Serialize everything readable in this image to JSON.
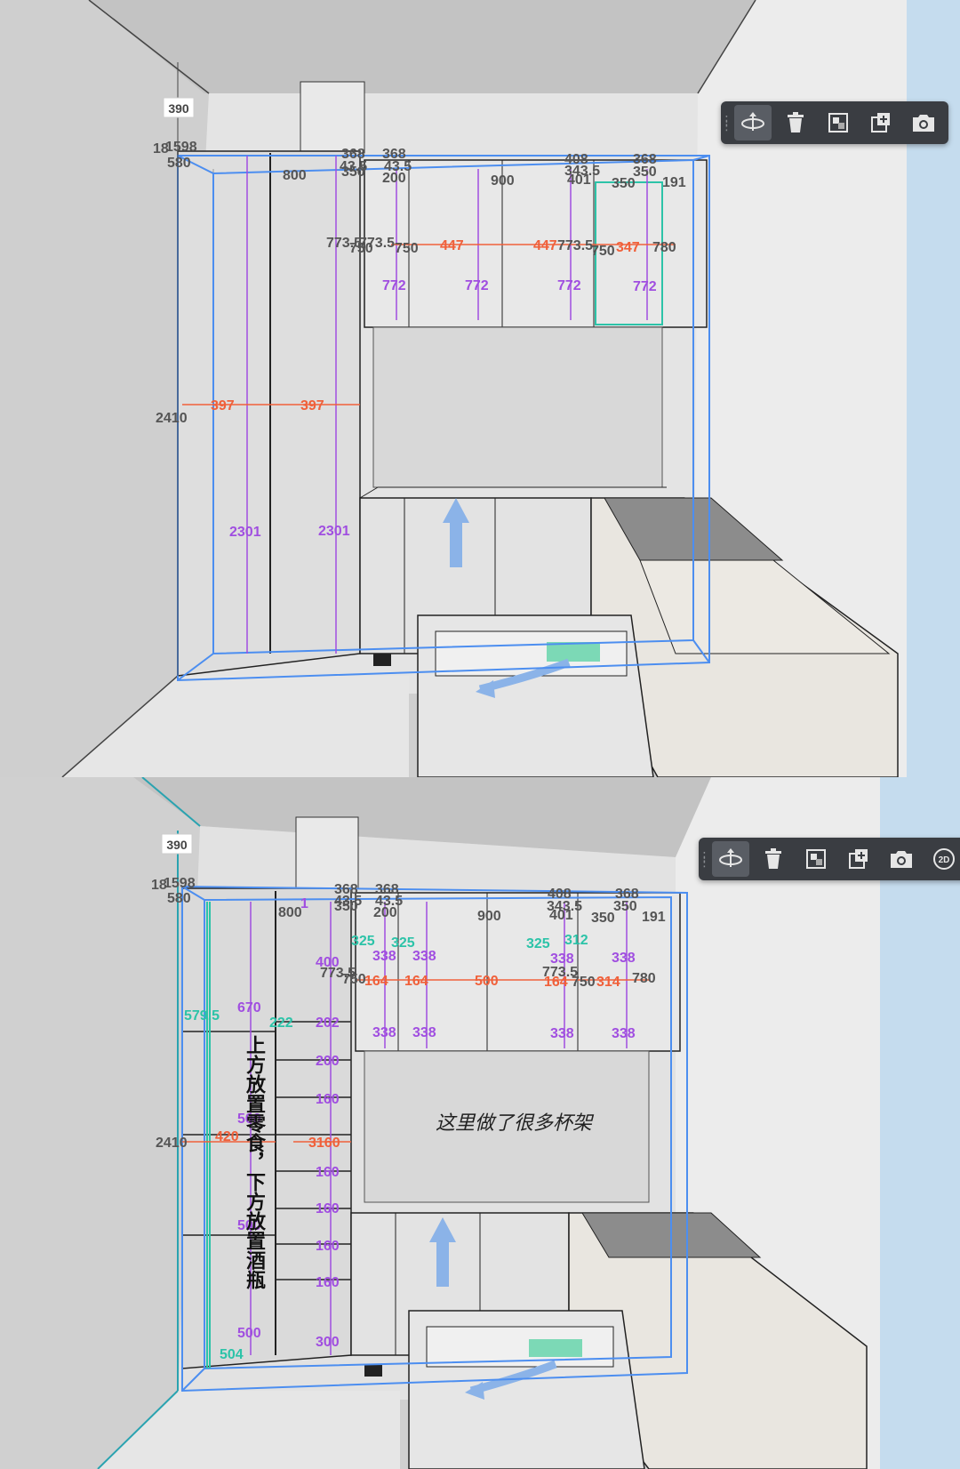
{
  "toolbar": {
    "tools": [
      {
        "name": "rotate",
        "icon": "rotate-3d-icon",
        "active": true
      },
      {
        "name": "delete",
        "icon": "trash-icon"
      },
      {
        "name": "replace",
        "icon": "replace-material-icon"
      },
      {
        "name": "add",
        "icon": "add-copy-icon"
      },
      {
        "name": "camera",
        "icon": "camera-view-icon"
      },
      {
        "name": "2d-view",
        "icon": "view-2d-icon",
        "label": "2D"
      }
    ]
  },
  "colors": {
    "selection": "#4c8ef0",
    "dimension_orange": "#f0603a",
    "dimension_purple": "#a04ee0",
    "dimension_teal": "#2cc3a8",
    "dimension_gray": "#555555",
    "toolbar_bg": "#3a3d42",
    "arrow": "#8bb3e8"
  },
  "top_view": {
    "labels": {
      "l390": "390",
      "l1598": "1598",
      "l18": "18",
      "l580": "580",
      "l800": "800",
      "l368a": "368",
      "l368b": "368",
      "l43_5a": "43.5",
      "l43_5b": "43.5",
      "l350": "350",
      "l200": "200",
      "l900": "900",
      "l408": "408",
      "l343_5": "343.5",
      "l401": "401",
      "l350b": "350",
      "l368c": "368",
      "l350c": "350",
      "l191": "191",
      "l773_5a": "773.5",
      "l773_5b": "773.5",
      "l750a": "750",
      "l750b": "750",
      "l447a": "447",
      "l447b": "447",
      "l773_5c": "773.5",
      "l750c": "750",
      "l347": "347",
      "l780": "780",
      "l772a": "772",
      "l772b": "772",
      "l772c": "772",
      "l772d": "772",
      "l2410": "2410",
      "l397a": "397",
      "l397b": "397",
      "l2301a": "2301",
      "l2301b": "2301"
    }
  },
  "bottom_view": {
    "labels": {
      "l390": "390",
      "l1598": "1598",
      "l18": "18",
      "l580": "580",
      "l1": "1",
      "l800": "800",
      "l368a": "368",
      "l368b": "368",
      "l43_5a": "43.5",
      "l43_5b": "43.5",
      "l350": "350",
      "l200": "200",
      "l900": "900",
      "l408": "408",
      "l343_5": "343.5",
      "l401": "401",
      "l350b": "350",
      "l368c": "368",
      "l350c": "350",
      "l191": "191",
      "l325a": "325",
      "l325b": "325",
      "l325c": "325",
      "l312": "312",
      "l338a": "338",
      "l338b": "338",
      "l338c": "338",
      "l338d": "338",
      "l400": "400",
      "l773_5a": "773.5",
      "l750a": "750",
      "l164a": "164",
      "l164b": "164",
      "l500": "500",
      "l164c": "164",
      "l773_5b": "773.5",
      "l750b": "750",
      "l314": "314",
      "l780": "780",
      "l338e": "338",
      "l338f": "338",
      "l338g": "338",
      "l338h": "338",
      "l670": "670",
      "l579_5": "579.5",
      "l222": "222",
      "l202": "202",
      "l200b": "200",
      "l160a": "160",
      "l500b": "500",
      "l2410": "2410",
      "l420": "420",
      "l3160": "3160",
      "l160b": "160",
      "l160c": "160",
      "l500c": "500",
      "l160d": "160",
      "l160e": "160",
      "l500d": "500",
      "l504": "504",
      "l300": "300",
      "annotation_cup_rack": "这里做了很多杯架",
      "annotation_vertical": "上方放置零食，下方放置酒瓶"
    }
  }
}
